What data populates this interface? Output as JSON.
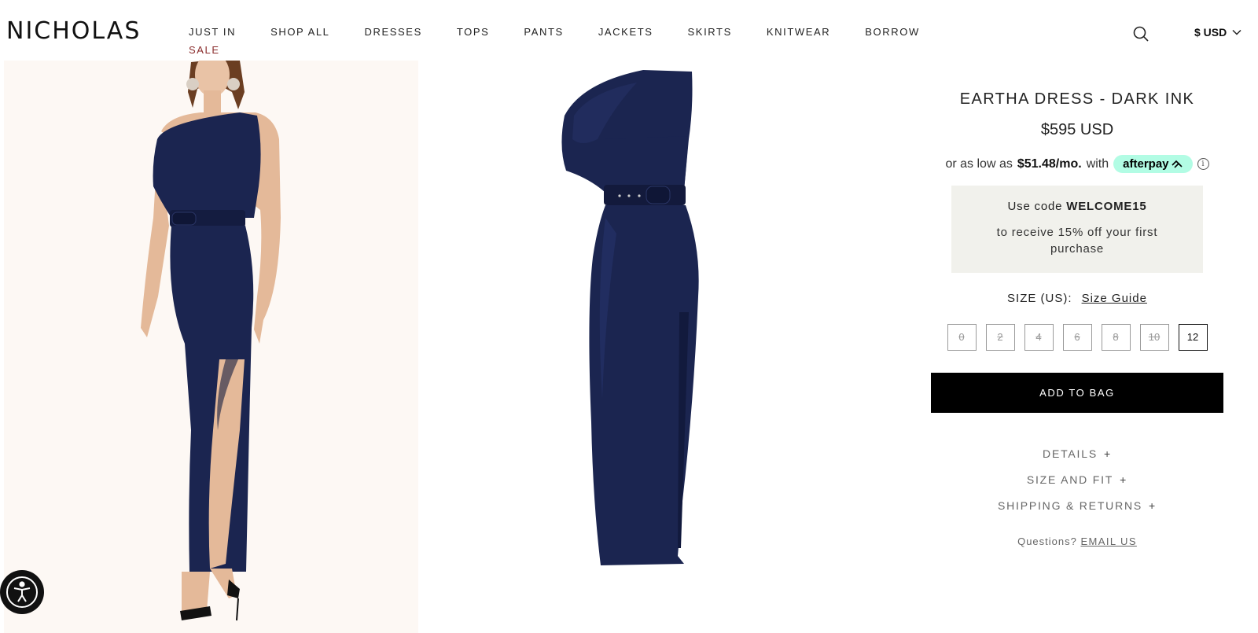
{
  "brand": {
    "logo_text": "NICHOLAS"
  },
  "nav": {
    "items": [
      "JUST IN",
      "SHOP ALL",
      "DRESSES",
      "TOPS",
      "PANTS",
      "JACKETS",
      "SKIRTS",
      "KNITWEAR",
      "BORROW"
    ],
    "sale_label": "SALE"
  },
  "header": {
    "currency": "$ USD",
    "search_icon": "search-icon",
    "chevron_icon": "chevron-down-icon"
  },
  "product": {
    "title": "EARTHA DRESS - DARK INK",
    "price": "$595 USD",
    "installment_prefix": "or as low as",
    "installment_amount": "$51.48/mo.",
    "installment_suffix": "with",
    "afterpay_label": "afterpay",
    "afterpay_color": "#b2fce4",
    "promo_prefix": "Use code",
    "promo_code": "WELCOME15",
    "promo_text": "to receive 15% off your first purchase",
    "size_label": "SIZE (US):",
    "size_guide": "Size Guide",
    "sizes": [
      {
        "label": "0",
        "available": false
      },
      {
        "label": "2",
        "available": false
      },
      {
        "label": "4",
        "available": false
      },
      {
        "label": "6",
        "available": false
      },
      {
        "label": "8",
        "available": false
      },
      {
        "label": "10",
        "available": false
      },
      {
        "label": "12",
        "available": true
      }
    ],
    "add_to_bag": "ADD TO BAG",
    "accordion": [
      "DETAILS",
      "SIZE AND FIT",
      "SHIPPING & RETURNS"
    ],
    "questions_prefix": "Questions?",
    "email_link": "EMAIL US"
  },
  "colors": {
    "dress": "#1b2550",
    "sale": "#8a2c2c",
    "button_bg": "#000000",
    "promo_bg": "#f1f1ec"
  }
}
